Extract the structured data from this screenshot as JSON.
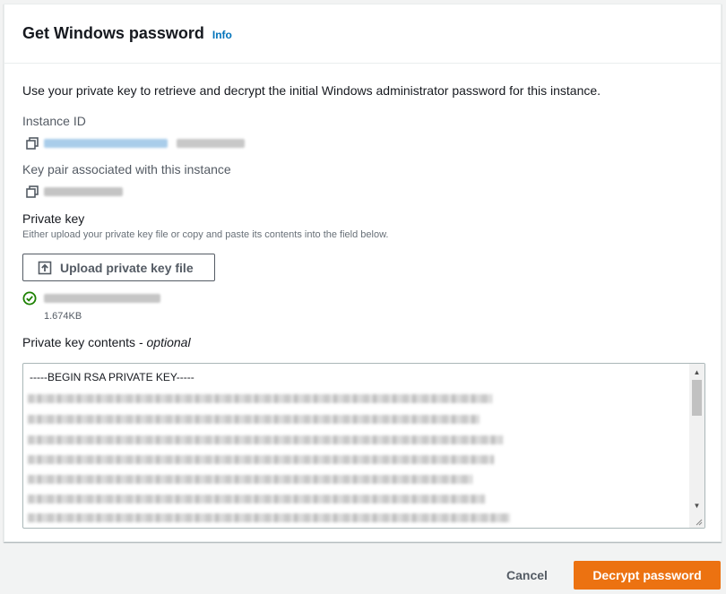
{
  "modal": {
    "title": "Get Windows password",
    "info_label": "Info",
    "description": "Use your private key to retrieve and decrypt the initial Windows administrator password for this instance."
  },
  "instance": {
    "label": "Instance ID",
    "value_icon": "copy-icon"
  },
  "key_pair": {
    "label": "Key pair associated with this instance",
    "value_icon": "copy-icon"
  },
  "private_key": {
    "label": "Private key",
    "hint": "Either upload your private key file or copy and paste its contents into the field below.",
    "upload_button": "Upload private key file",
    "upload_icon": "upload-icon",
    "file_status_icon": "check-circle-icon",
    "file_size": "1.674KB",
    "contents_label": "Private key contents - ",
    "contents_optional": "optional",
    "contents_first_line": "-----BEGIN RSA PRIVATE KEY-----"
  },
  "footer": {
    "cancel": "Cancel",
    "primary": "Decrypt password"
  },
  "colors": {
    "primary": "#ec7211",
    "link": "#0073bb",
    "success": "#1d8102",
    "text": "#16191f",
    "secondary_text": "#545b64"
  }
}
